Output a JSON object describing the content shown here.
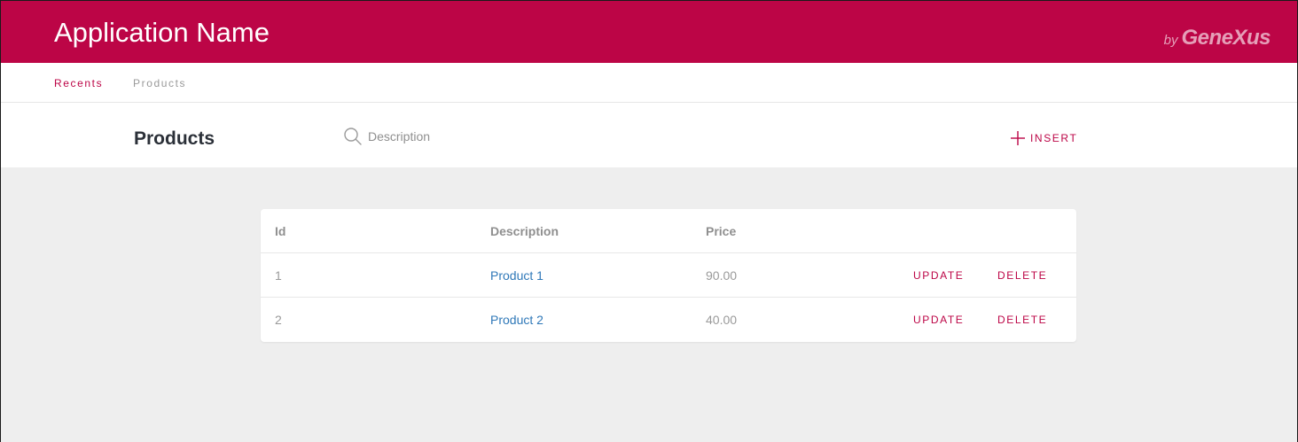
{
  "header": {
    "app_name": "Application Name",
    "brand_by": "by",
    "brand_name": "GeneXus"
  },
  "tabs": [
    {
      "label": "Recents",
      "active": true
    },
    {
      "label": "Products",
      "active": false
    }
  ],
  "toolbar": {
    "title": "Products",
    "search_placeholder": "Description",
    "search_value": "",
    "insert_label": "INSERT"
  },
  "table": {
    "columns": [
      "Id",
      "Description",
      "Price"
    ],
    "rows": [
      {
        "id": "1",
        "description": "Product 1",
        "price": "90.00",
        "update_label": "UPDATE",
        "delete_label": "DELETE"
      },
      {
        "id": "2",
        "description": "Product 2",
        "price": "40.00",
        "update_label": "UPDATE",
        "delete_label": "DELETE"
      }
    ]
  },
  "icons": {
    "search": "search-icon",
    "insert": "plus-icon"
  },
  "colors": {
    "brand": "#bc0546",
    "link": "#2f78b8",
    "background": "#eeeeee"
  }
}
